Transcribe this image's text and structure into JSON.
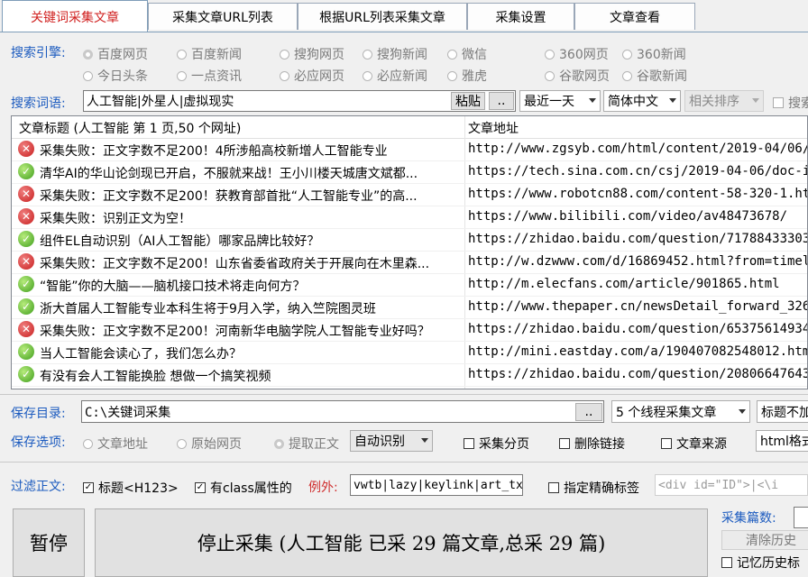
{
  "tabs": [
    "关键词采集文章",
    "采集文章URL列表",
    "根据URL列表采集文章",
    "采集设置",
    "文章查看"
  ],
  "engine": {
    "label": "搜索引擎:",
    "options": [
      {
        "label": "百度网页",
        "selected": true
      },
      {
        "label": "百度新闻",
        "selected": false
      },
      {
        "label": "搜狗网页",
        "selected": false
      },
      {
        "label": "搜狗新闻",
        "selected": false
      },
      {
        "label": "微信",
        "selected": false
      },
      {
        "label": "360网页",
        "selected": false
      },
      {
        "label": "360新闻",
        "selected": false
      },
      {
        "label": "今日头条",
        "selected": false
      },
      {
        "label": "一点资讯",
        "selected": false
      },
      {
        "label": "必应网页",
        "selected": false
      },
      {
        "label": "必应新闻",
        "selected": false
      },
      {
        "label": "雅虎",
        "selected": false
      },
      {
        "label": "谷歌网页",
        "selected": false
      },
      {
        "label": "谷歌新闻",
        "selected": false
      }
    ]
  },
  "keywords": {
    "label": "搜索词语:",
    "value": "人工智能|外星人|虚拟现实",
    "paste": "粘贴",
    "browse": "..",
    "time": "最近一天",
    "lang": "简体中文",
    "sort": "相关排序",
    "search_partial": "搜索"
  },
  "table": {
    "col_title": "文章标题 (人工智能 第 1 页,50 个网址)",
    "col_url": "文章地址",
    "rows": [
      {
        "status": "fail",
        "title": "采集失败：正文字数不足200！4所涉船高校新增人工智能专业",
        "url": "http://www.zgsyb.com/html/content/2019-04/06/..."
      },
      {
        "status": "ok",
        "title": "清华AI的华山论剑现已开启，不服就来战！王小川楼天城唐文斌都...",
        "url": "https://tech.sina.com.cn/csj/2019-04-06/doc-i..."
      },
      {
        "status": "fail",
        "title": "采集失败：正文字数不足200！获教育部首批“人工智能专业”的高...",
        "url": "https://www.robotcn88.com/content-58-320-1.html"
      },
      {
        "status": "fail",
        "title": "采集失败：识别正文为空！",
        "url": "https://www.bilibili.com/video/av48473678/"
      },
      {
        "status": "ok",
        "title": "组件EL自动识别（AI人工智能）哪家品牌比较好？",
        "url": "https://zhidao.baidu.com/question/71788433303..."
      },
      {
        "status": "fail",
        "title": "采集失败：正文字数不足200！山东省委省政府关于开展向在木里森...",
        "url": "http://w.dzwww.com/d/16869452.html?from=timel..."
      },
      {
        "status": "ok",
        "title": "“智能”你的大脑——脑机接口技术将走向何方？",
        "url": "http://m.elecfans.com/article/901865.html"
      },
      {
        "status": "ok",
        "title": "浙大首届人工智能专业本科生将于9月入学，纳入竺院图灵班",
        "url": "http://www.thepaper.cn/newsDetail_forward_326..."
      },
      {
        "status": "fail",
        "title": "采集失败：正文字数不足200！河南新华电脑学院人工智能专业好吗？",
        "url": "https://zhidao.baidu.com/question/65375614934..."
      },
      {
        "status": "ok",
        "title": "当人工智能会读心了，我们怎么办？",
        "url": "http://mini.eastday.com/a/190407082548012.html"
      },
      {
        "status": "ok",
        "title": "有没有会人工智能换脸 想做一个搞笑视频",
        "url": "https://zhidao.baidu.com/question/20806647643..."
      }
    ]
  },
  "save_dir": {
    "label": "保存目录:",
    "value": "C:\\关键词采集",
    "browse": "..",
    "threads": "5 个线程采集文章",
    "title_partial": "标题不加"
  },
  "save_opts": {
    "label": "保存选项:",
    "article_url": "文章地址",
    "original_page": "原始网页",
    "extract": "提取正文",
    "auto": "自动识别",
    "paging": "采集分页",
    "del_links": "删除链接",
    "source": "文章来源",
    "html_partial": "html格式"
  },
  "filter": {
    "label": "过滤正文:",
    "title_tags": "标题<H123>",
    "class_attr": "有class属性的",
    "except_label": "例外:",
    "except_value": "vwtb|lazy|keylink|art_tx",
    "precise": "指定精确标签",
    "tag_placeholder": "<div id=\"ID\">|<\\i"
  },
  "actions": {
    "pause": "暂停",
    "stop": "停止采集 (人工智能 已采 29 篇文章,总采 29 篇)",
    "count_label": "采集篇数:",
    "clear": "清除历史",
    "remember": "记忆历史标"
  }
}
